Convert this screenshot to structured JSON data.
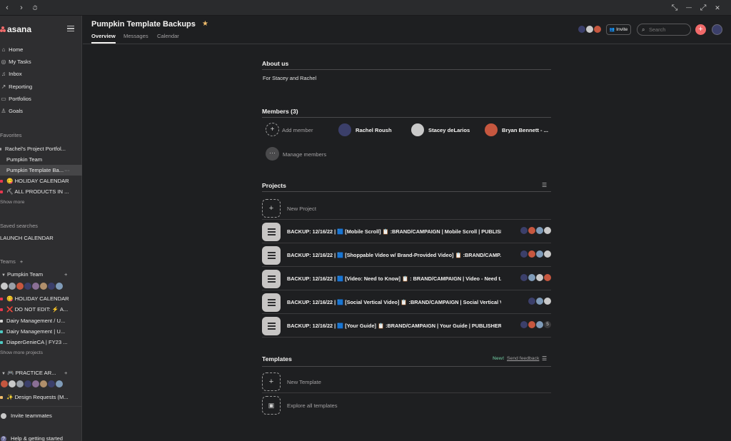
{
  "app": {
    "name": "asana"
  },
  "titlebar": {
    "back": "‹",
    "forward": "›",
    "history": "⏱",
    "restore": "⤡",
    "minimize": "—",
    "maximize": "⤢",
    "close": "✕"
  },
  "sidebar": {
    "nav": [
      {
        "label": "Home",
        "icon": "home-icon"
      },
      {
        "label": "My Tasks",
        "icon": "check-circle-icon"
      },
      {
        "label": "Inbox",
        "icon": "bell-icon"
      },
      {
        "label": "Reporting",
        "icon": "chart-icon"
      },
      {
        "label": "Portfolios",
        "icon": "portfolio-icon"
      },
      {
        "label": "Goals",
        "icon": "person-icon"
      }
    ],
    "favorites_heading": "Favorites",
    "favorites": [
      {
        "label": "Rachel's Project Portfol...",
        "color": "#a2a0a2"
      },
      {
        "label": "Pumpkin Team",
        "color": ""
      },
      {
        "label": "Pumpkin Template Ba...",
        "color": "",
        "more": "···"
      },
      {
        "label": "😋 HOLIDAY CALENDAR",
        "color": "#e8384f"
      },
      {
        "label": "⛏ ALL PRODUCTS IN ...",
        "color": "#e8384f"
      }
    ],
    "favorites_more": "Show more",
    "saved_heading": "Saved searches",
    "saved": [
      {
        "label": "LAUNCH CALENDAR"
      }
    ],
    "teams_heading": "Teams",
    "teams_add": "+",
    "team1": {
      "name": "Pumpkin Team",
      "add": "+",
      "projects": [
        {
          "label": "😋 HOLIDAY CALENDAR",
          "color": "#e8384f"
        },
        {
          "label": "❌ DO NOT EDIT: ⚡ A...",
          "color": "#e8384f"
        },
        {
          "label": "Dairy Management / U...",
          "color": "#d5d5d5"
        },
        {
          "label": "Dairy Management | U...",
          "color": "#4ecbc4"
        },
        {
          "label": "DiaperGenieCA | FY23 ...",
          "color": "#4ecbc4"
        }
      ],
      "more": "Show more projects"
    },
    "team2": {
      "name": "🎮 PRACTICE AR...",
      "add": "+",
      "projects": [
        {
          "label": "✨ Design Requests (M...",
          "color": "#f1bd6c"
        }
      ]
    },
    "invite": "Invite teammates",
    "help": "Help & getting started"
  },
  "header": {
    "title": "Pumpkin Template Backups",
    "star": "★",
    "tabs": [
      "Overview",
      "Messages",
      "Calendar"
    ],
    "invite_label": "Invite",
    "search_placeholder": "Search",
    "add": "+"
  },
  "about": {
    "heading": "About us",
    "text": "For Stacey and Rachel"
  },
  "members": {
    "heading": "Members (3)",
    "add_label": "Add member",
    "manage_label": "Manage members",
    "list": [
      {
        "name": "Rachel Roush",
        "color": "#3b3f6a"
      },
      {
        "name": "Stacey deLarios",
        "color": "#c9c9c9"
      },
      {
        "name": "Bryan Bennett - ...",
        "color": "#c6573f"
      }
    ]
  },
  "projects": {
    "heading": "Projects",
    "new_label": "New Project",
    "list": [
      {
        "name": "BACKUP: 12/16/22 | 🟦 [Mobile Scroll] 📋 :BRAND/CAMPAIGN | Mobile Scroll | PUBLISH..."
      },
      {
        "name": "BACKUP: 12/16/22 | 🟦 [Shoppable Video w/ Brand-Provided Video] 📋 :BRAND/CAMP..."
      },
      {
        "name": "BACKUP: 12/16/22 | 🟦 [Video: Need to Know] 📋 : BRAND/CAMPAIGN | Video - Need t..."
      },
      {
        "name": "BACKUP: 12/16/22 | 🟦 [Social Vertical Video] 📋 :BRAND/CAMPAIGN | Social Vertical Vide..."
      },
      {
        "name": "BACKUP: 12/16/22 | 🟦 [Your Guide] 📋 :BRAND/CAMPAIGN | Your Guide | PUBLISHER |...",
        "extra": "5"
      }
    ]
  },
  "templates": {
    "heading": "Templates",
    "new_badge": "New!",
    "feedback": "Send feedback",
    "new_label": "New Template",
    "explore_label": "Explore all templates"
  },
  "colors": {
    "bg": "#1e1f21",
    "sidebar": "#2e2e30",
    "accent": "#f06a6a",
    "new_badge": "#5da283"
  }
}
